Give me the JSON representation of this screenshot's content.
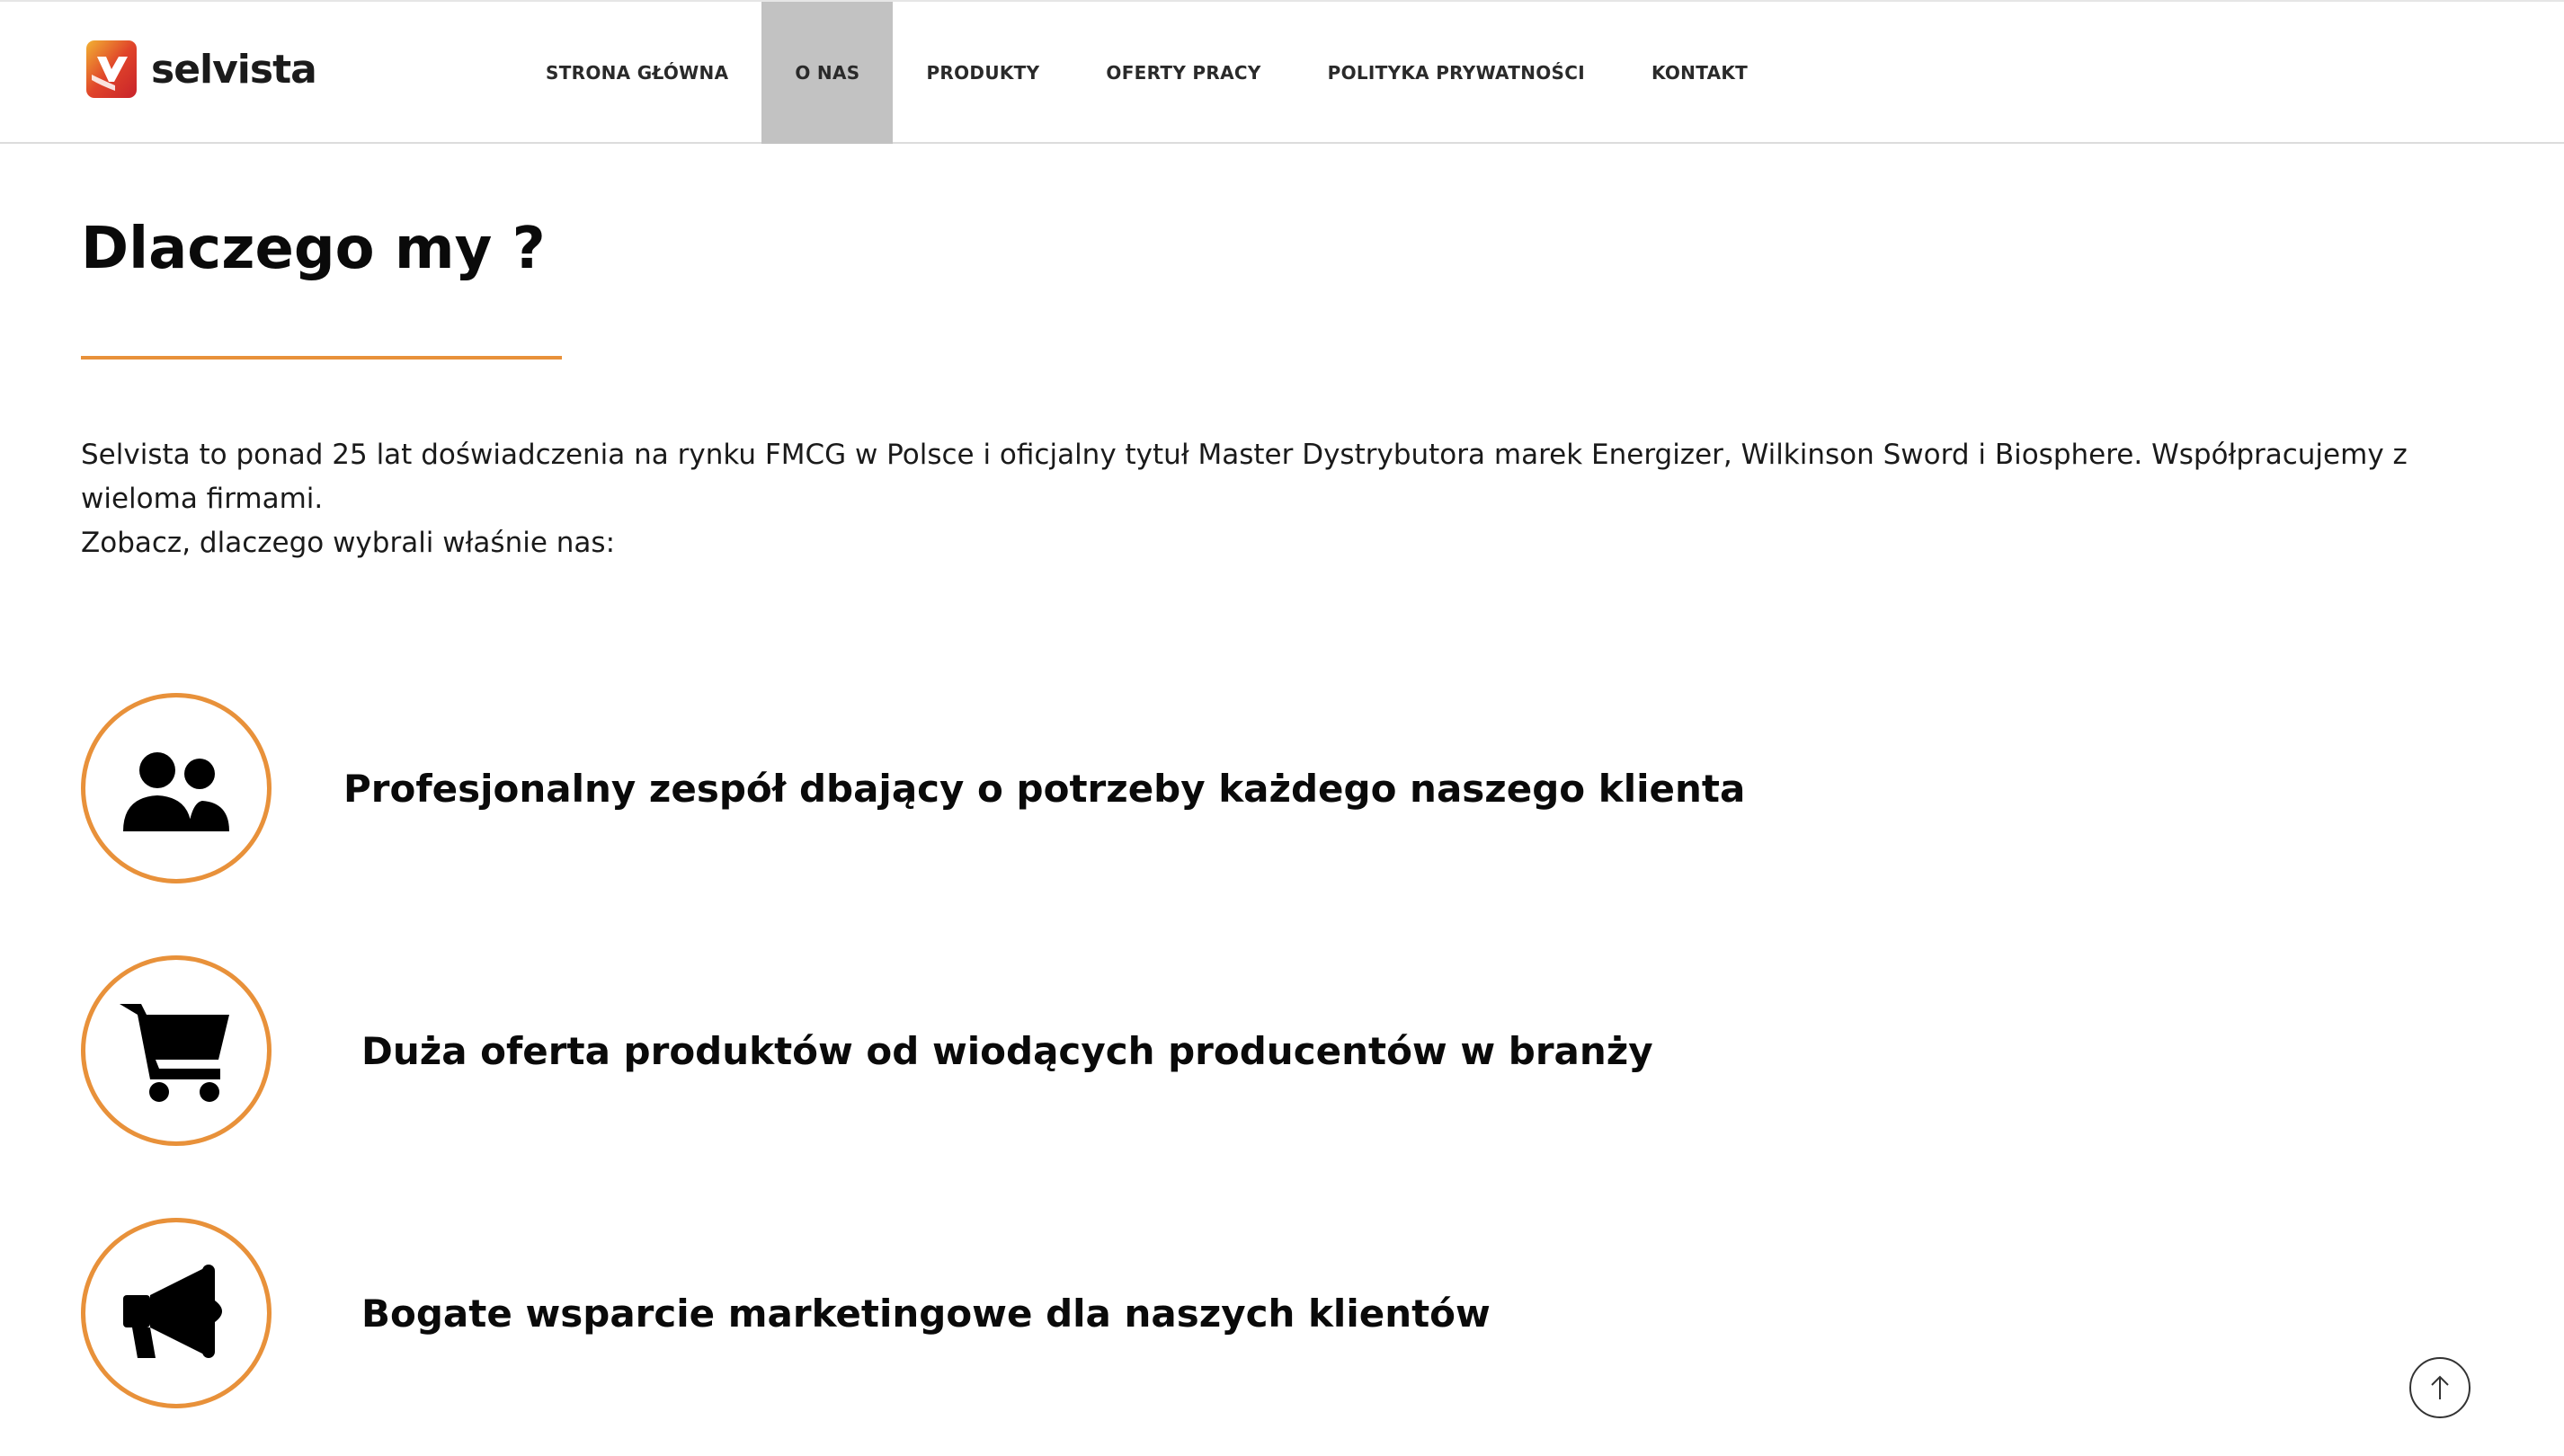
{
  "brand": {
    "name": "selvista",
    "accent": "#e8913a",
    "logo_colors": [
      "#f2b233",
      "#e0442a",
      "#c8232b"
    ]
  },
  "nav": {
    "items": [
      {
        "label": "STRONA GŁÓWNA",
        "active": false
      },
      {
        "label": "O NAS",
        "active": true
      },
      {
        "label": "PRODUKTY",
        "active": false
      },
      {
        "label": "OFERTY PRACY",
        "active": false
      },
      {
        "label": "POLITYKA PRYWATNOŚCI",
        "active": false
      },
      {
        "label": "KONTAKT",
        "active": false
      }
    ]
  },
  "main": {
    "title": "Dlaczego my ?",
    "intro_line1": "Selvista to ponad 25 lat doświadczenia na rynku FMCG w Polsce i oficjalny tytuł Master Dystrybutora marek Energizer, Wilkinson Sword i Biosphere. Współpracujemy z wieloma firmami.",
    "intro_line2": "Zobacz, dlaczego wybrali właśnie nas:",
    "features": [
      {
        "icon": "users-icon",
        "text": "Profesjonalny zespół dbający o potrzeby każdego naszego klienta"
      },
      {
        "icon": "shopping-cart-icon",
        "text": "Duża oferta produktów od wiodących producentów w branży"
      },
      {
        "icon": "megaphone-icon",
        "text": "Bogate wsparcie marketingowe dla naszych klientów"
      }
    ]
  },
  "scroll_top": {
    "icon": "arrow-up-icon"
  }
}
